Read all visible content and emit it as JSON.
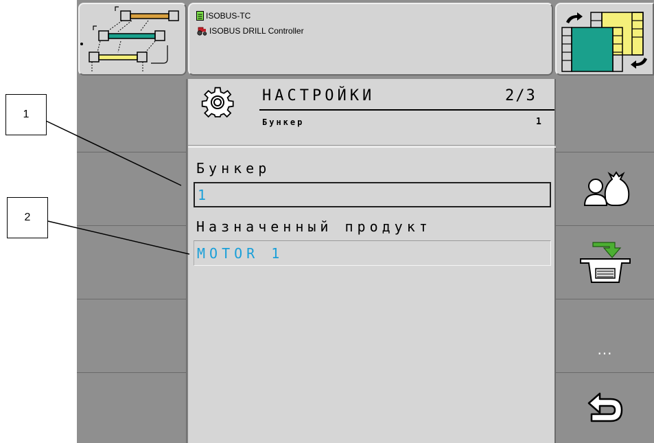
{
  "header": {
    "line1": "ISOBUS-TC",
    "line2": "ISOBUS DRILL Controller"
  },
  "screen": {
    "title": "НАСТРОЙКИ",
    "page": "2/3",
    "subtitle": "Бункер",
    "subtitle_value": "1"
  },
  "fields": {
    "hopper_label": "Бункер",
    "hopper_value": "1",
    "product_label": "Назначенный продукт",
    "product_value": "MOTOR 1"
  },
  "softkeys": {
    "more_label": "..."
  },
  "callouts": {
    "c1": "1",
    "c2": "2"
  },
  "colors": {
    "value_blue": "#1a9fd8",
    "panel_gray": "#d6d6d6",
    "softkey_gray": "#8f8f8f",
    "teal": "#1aa08c",
    "yellow": "#f5f07a",
    "orange": "#d8a040",
    "arrow_green": "#4caf32"
  },
  "icons": {
    "top_left": "section-control-icon",
    "top_right": "tc-switch-icon",
    "settings": "gear-icon",
    "product_assign": "operator-product-sack-icon",
    "load": "hopper-load-icon",
    "back": "back-arrow-icon"
  }
}
